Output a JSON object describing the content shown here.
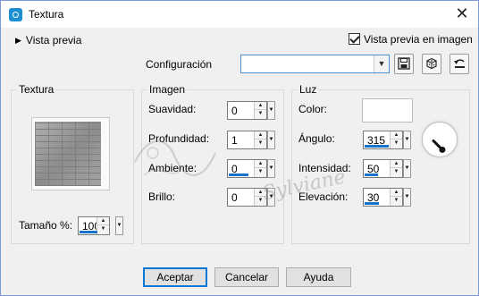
{
  "window": {
    "title": "Textura",
    "app_icon": "psp-dialog-icon",
    "close_label": "✕"
  },
  "top": {
    "preview_toggle": "Vista previa",
    "realtime_preview": "Vista previa en imagen",
    "realtime_checked": true,
    "preset_label": "Configuración",
    "preset_value": ""
  },
  "texture_group": {
    "title": "Textura",
    "size_label": "Tamaño %:",
    "size_value": "100"
  },
  "image_group": {
    "title": "Imagen",
    "fields": [
      {
        "label": "Suavidad:",
        "value": "0"
      },
      {
        "label": "Profundidad:",
        "value": "1"
      },
      {
        "label": "Ambiente:",
        "value": "0"
      },
      {
        "label": "Brillo:",
        "value": "0"
      }
    ]
  },
  "light_group": {
    "title": "Luz",
    "color_label": "Color:",
    "color_value": "#ffffff",
    "fields": [
      {
        "label": "Ángulo:",
        "value": "315"
      },
      {
        "label": "Intensidad:",
        "value": "50"
      },
      {
        "label": "Elevación:",
        "value": "30"
      }
    ]
  },
  "watermark": "Sylviane",
  "buttons": {
    "ok": "Aceptar",
    "cancel": "Cancelar",
    "help": "Ayuda"
  },
  "colors": {
    "accent": "#1a73c7",
    "focus_border": "#0078d7",
    "title_bar": "#ffffff",
    "dialog_bg": "#f0f0f0"
  }
}
